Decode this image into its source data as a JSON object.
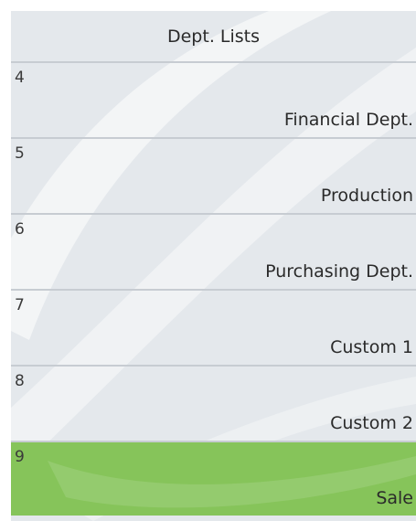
{
  "title": "Dept. Lists",
  "departments": [
    {
      "number": "4",
      "name": "Financial Dept."
    },
    {
      "number": "5",
      "name": "Production"
    },
    {
      "number": "6",
      "name": "Purchasing Dept."
    },
    {
      "number": "7",
      "name": "Custom 1"
    },
    {
      "number": "8",
      "name": "Custom 2"
    },
    {
      "number": "9",
      "name": "Sale"
    }
  ],
  "selected_index": 5,
  "colors": {
    "panel_background": "#e4e8ec",
    "selected_row": "#86c45a",
    "divider": "#c7ccd2"
  }
}
